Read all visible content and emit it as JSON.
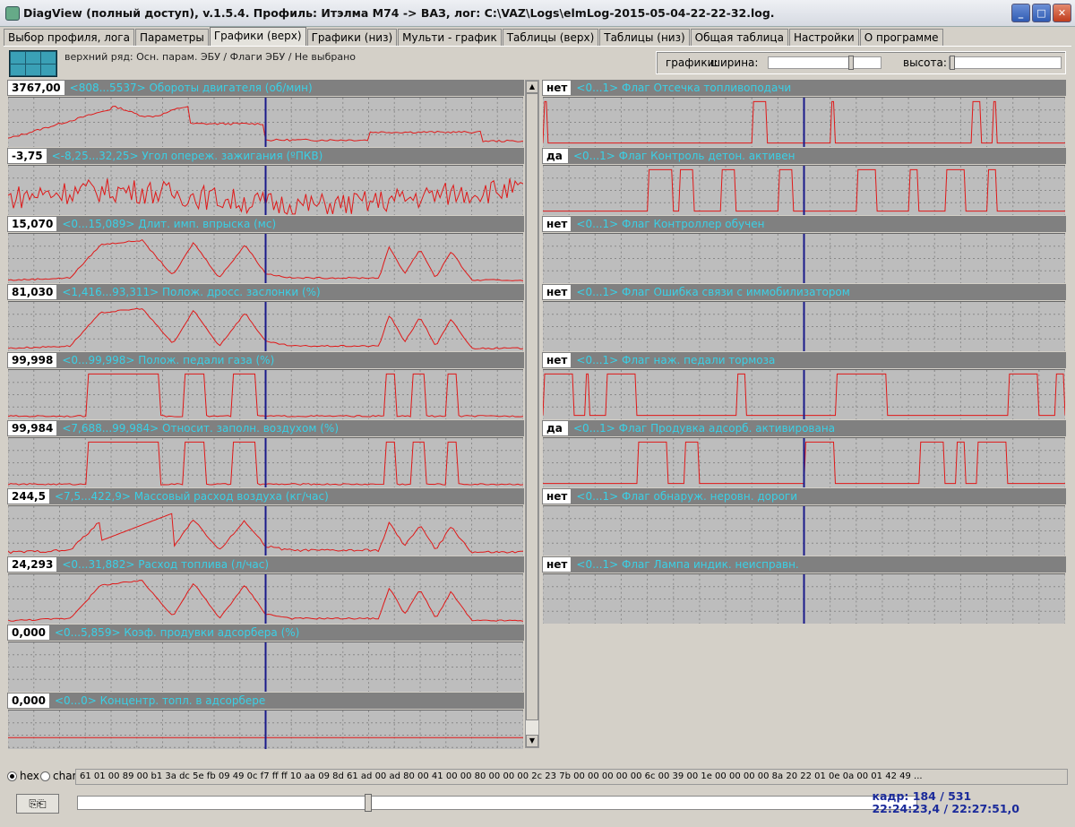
{
  "window": {
    "title": "DiagView (полный доступ), v.1.5.4. Профиль: Итэлма М74 -> ВАЗ,   лог: C:\\VAZ\\Logs\\elmLog-2015-05-04-22-22-32.log."
  },
  "tabs": [
    {
      "label": "Выбор профиля, лога",
      "active": false
    },
    {
      "label": "Параметры",
      "active": false
    },
    {
      "label": "Графики (верх)",
      "active": true
    },
    {
      "label": "Графики (низ)",
      "active": false
    },
    {
      "label": "Мульти - график",
      "active": false
    },
    {
      "label": "Таблицы (верх)",
      "active": false
    },
    {
      "label": "Таблицы (низ)",
      "active": false
    },
    {
      "label": "Общая таблица",
      "active": false
    },
    {
      "label": "Настройки",
      "active": false
    },
    {
      "label": "О программе",
      "active": false
    }
  ],
  "toolbar": {
    "caption": "верхний ряд: Осн. парам. ЭБУ / Флаги ЭБУ / Не выбрано",
    "graphs_label": "графики:",
    "width_label": "ширина:",
    "height_label": "высота:",
    "width_level": 0.75,
    "height_level": 0.0
  },
  "left_charts": [
    {
      "value": "3767,00",
      "label": "<808...5537> Обороты двигателя (об/мин)",
      "kind": "rpm"
    },
    {
      "value": "-3,75",
      "label": "<-8,25...32,25> Угол опереж. зажигания (ºПКВ)",
      "kind": "noise"
    },
    {
      "value": "15,070",
      "label": "<0...15,089> Длит. имп. впрыска (мс)",
      "kind": "pulse"
    },
    {
      "value": "81,030",
      "label": "<1,416...93,311> Полож. дросс. заслонки (%)",
      "kind": "pulse"
    },
    {
      "value": "99,998",
      "label": "<0...99,998> Полож. педали газа (%)",
      "kind": "pulse2"
    },
    {
      "value": "99,984",
      "label": "<7,688...99,984> Относит. заполн. воздухом (%)",
      "kind": "pulse2"
    },
    {
      "value": "244,5",
      "label": "<7,5...422,9> Массовый расход воздуха (кг/час)",
      "kind": "maf"
    },
    {
      "value": "24,293",
      "label": "<0...31,882> Расход топлива (л/час)",
      "kind": "pulse"
    },
    {
      "value": "0,000",
      "label": "<0...5,859> Коэф. продувки адсорбера (%)",
      "kind": "empty"
    },
    {
      "value": "0,000",
      "label": "<0...0> Концентр. топл. в адсорбере",
      "kind": "flatline"
    }
  ],
  "right_charts": [
    {
      "value": "нет",
      "label": "<0...1> Флаг Отсечка топливоподачи",
      "kind": "flag1"
    },
    {
      "value": "да",
      "label": "<0...1> Флаг Контроль детон. активен",
      "kind": "flag2"
    },
    {
      "value": "нет",
      "label": "<0...1> Флаг Контроллер обучен",
      "kind": "empty"
    },
    {
      "value": "нет",
      "label": "<0...1> Флаг Ошибка связи с иммобилизатором",
      "kind": "empty"
    },
    {
      "value": "нет",
      "label": "<0...1> Флаг наж. педали тормоза",
      "kind": "flag3"
    },
    {
      "value": "да",
      "label": "<0...1> Флаг Продувка адсорб. активирована",
      "kind": "flag4"
    },
    {
      "value": "нет",
      "label": "<0...1> Флаг обнаруж. неровн. дороги",
      "kind": "empty"
    },
    {
      "value": "нет",
      "label": "<0...1> Флаг Лампа индик. неисправн.",
      "kind": "empty"
    }
  ],
  "cursor_position": 0.5,
  "hexbar": {
    "hex_label": "hex",
    "char_label": "char",
    "data": "61 01 00 89 00 b1 3a dc 5e fb 09 49 0c f7 ff ff 10 aa 09 8d 61 ad 00 ad 80 00 41 00 00 80 00 00 00 2c 23 7b 00 00 00 00 00 6c 00 39 00 1e 00 00 00 00 8a 20 22 01 0e 0a 00 01 42 49 ..."
  },
  "timeline": {
    "position": 0.345
  },
  "frame": {
    "line1": "кадр: 184 / 531",
    "line2": "22:24:23,4 / 22:27:51,0"
  },
  "copy_button": "⎘⎗",
  "colors": {
    "signal": "#e01818",
    "cursor": "#1a1a8a",
    "label": "#3ad0e6"
  }
}
